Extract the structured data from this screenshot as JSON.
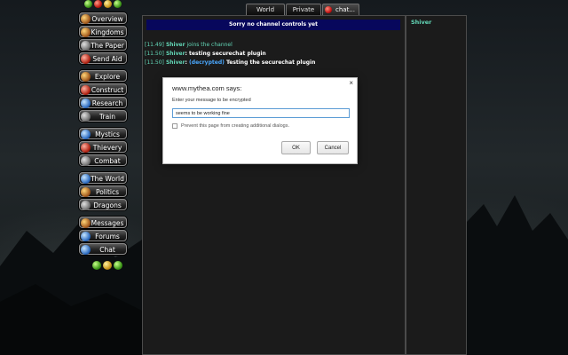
{
  "top_icons": [
    "green-orb-icon",
    "red-orb-icon",
    "gold-orb-icon",
    "green-orb-icon"
  ],
  "nav": {
    "items": [
      {
        "label": "Overview",
        "icon": "sun-icon"
      },
      {
        "label": "Kingdoms",
        "icon": "crown-icon"
      },
      {
        "label": "The Paper",
        "icon": "scroll-icon"
      },
      {
        "label": "Send Aid",
        "icon": "gift-icon"
      },
      {
        "label": "Explore",
        "icon": "compass-icon"
      },
      {
        "label": "Construct",
        "icon": "hammer-icon"
      },
      {
        "label": "Research",
        "icon": "potion-icon"
      },
      {
        "label": "Train",
        "icon": "sword-icon"
      },
      {
        "label": "Mystics",
        "icon": "crystal-icon"
      },
      {
        "label": "Thievery",
        "icon": "dagger-icon"
      },
      {
        "label": "Combat",
        "icon": "shield-icon"
      },
      {
        "label": "The World",
        "icon": "globe-icon"
      },
      {
        "label": "Politics",
        "icon": "flag-icon"
      },
      {
        "label": "Dragons",
        "icon": "dragon-icon"
      },
      {
        "label": "Messages",
        "icon": "envelope-icon"
      },
      {
        "label": "Forums",
        "icon": "forum-icon"
      },
      {
        "label": "Chat",
        "icon": "chat-bubble-icon"
      }
    ]
  },
  "bottom_icons": [
    "green-orb-icon",
    "gold-orb-icon",
    "green-orb-icon"
  ],
  "tabs": {
    "world": "World",
    "private": "Private",
    "chat": "chat..."
  },
  "chat": {
    "header": "Sorry no channel controls yet",
    "messages": [
      {
        "time": "[11.49]",
        "user": "Shiver",
        "text": " joins the channel",
        "type": "join"
      },
      {
        "time": "[11.50]",
        "user": "Shiver",
        "text": ": testing securechat plugin",
        "type": "msg"
      },
      {
        "time": "[11.50]",
        "user": "Shiver",
        "tag": "(decrypted)",
        "text": " Testing the securechat plugin",
        "type": "decrypted"
      }
    ]
  },
  "users": [
    "Shiver"
  ],
  "dialog": {
    "title": "www.mythea.com says:",
    "prompt": "Enter your message to be encrypted",
    "input_value": "seems to be working fine",
    "checkbox_label": "Prevent this page from creating additional dialogs.",
    "ok_label": "OK",
    "cancel_label": "Cancel",
    "close_glyph": "×"
  },
  "colors": {
    "accent_teal": "#62d6b6",
    "header_navy": "#07075c",
    "decrypted_blue": "#4aa8ff"
  }
}
